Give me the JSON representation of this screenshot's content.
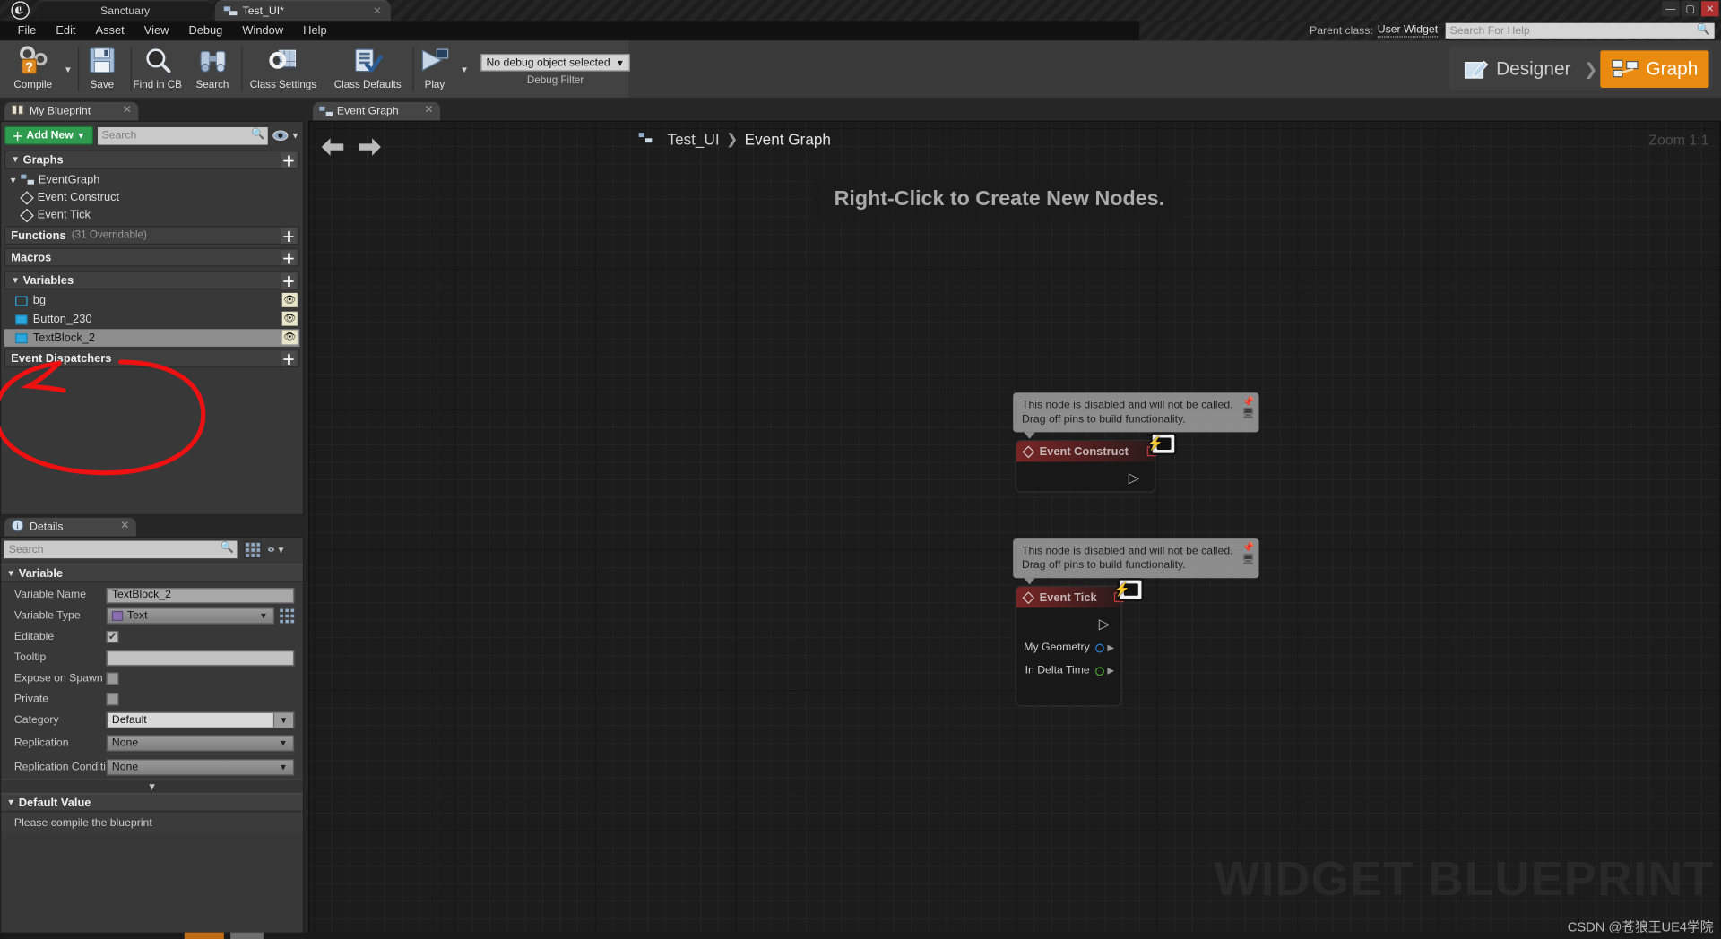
{
  "window": {
    "project_tab": "Sanctuary",
    "asset_tab": "Test_UI*",
    "minimize": "—",
    "maximize": "▢",
    "close": "✕"
  },
  "menu": {
    "items": [
      "File",
      "Edit",
      "Asset",
      "View",
      "Debug",
      "Window",
      "Help"
    ]
  },
  "help": {
    "parent_label": "Parent class:",
    "parent_value": "User Widget",
    "search_placeholder": "Search For Help"
  },
  "toolbar": {
    "compile": "Compile",
    "save": "Save",
    "find_in_cb": "Find in CB",
    "search": "Search",
    "class_settings": "Class Settings",
    "class_defaults": "Class Defaults",
    "play": "Play",
    "debug_object": "No debug object selected",
    "debug_filter": "Debug Filter",
    "mode_designer": "Designer",
    "mode_graph": "Graph",
    "mode_separator": "❯"
  },
  "my_blueprint": {
    "tab_title": "My Blueprint",
    "add_new": "Add New",
    "search_placeholder": "Search",
    "sections": {
      "graphs": "Graphs",
      "functions": "Functions",
      "functions_sub": "(31 Overridable)",
      "macros": "Macros",
      "variables": "Variables",
      "event_dispatchers": "Event Dispatchers"
    },
    "graph_tree": {
      "event_graph": "EventGraph",
      "event_construct": "Event Construct",
      "event_tick": "Event Tick"
    },
    "variables": [
      {
        "name": "bg",
        "icon": "image-variable-icon",
        "selected": false
      },
      {
        "name": "Button_230",
        "icon": "button-variable-icon",
        "selected": false
      },
      {
        "name": "TextBlock_2",
        "icon": "text-variable-icon",
        "selected": true
      }
    ]
  },
  "details": {
    "tab_title": "Details",
    "search_placeholder": "Search",
    "category_variable": "Variable",
    "category_default_value": "Default Value",
    "rows": [
      {
        "label": "Variable Name",
        "value": "TextBlock_2",
        "kind": "text"
      },
      {
        "label": "Variable Type",
        "value": "Text",
        "kind": "combo-type"
      },
      {
        "label": "Editable",
        "value": "checked",
        "kind": "checkbox"
      },
      {
        "label": "Tooltip",
        "value": "",
        "kind": "text"
      },
      {
        "label": "Expose on Spawn",
        "value": "unchecked",
        "kind": "checkbox"
      },
      {
        "label": "Private",
        "value": "unchecked",
        "kind": "checkbox"
      },
      {
        "label": "Category",
        "value": "Default",
        "kind": "combo-light"
      },
      {
        "label": "Replication",
        "value": "None",
        "kind": "combo"
      },
      {
        "label": "Replication Conditi",
        "value": "None",
        "kind": "combo"
      }
    ],
    "default_value_message": "Please compile the blueprint"
  },
  "graph": {
    "tab_title": "Event Graph",
    "breadcrumb_asset": "Test_UI",
    "breadcrumb_graph": "Event Graph",
    "breadcrumb_separator": "❯",
    "nav_back": "⬅",
    "nav_forward": "➡",
    "zoom_label": "Zoom 1:1",
    "hint": "Right-Click to Create New Nodes.",
    "watermark": "WIDGET BLUEPRINT",
    "credit": "CSDN @苍狼王UE4学院",
    "nodes": [
      {
        "title": "Event Construct",
        "tooltip_line1": "This node is disabled and will not be called.",
        "tooltip_line2": "Drag off pins to build functionality.",
        "pins": []
      },
      {
        "title": "Event Tick",
        "tooltip_line1": "This node is disabled and will not be called.",
        "tooltip_line2": "Drag off pins to build functionality.",
        "pins": [
          "My Geometry",
          "In Delta Time"
        ]
      }
    ]
  },
  "colors": {
    "accent_orange": "#e98b10",
    "add_new_green": "#2e9b4e",
    "selection_gray": "#8d8d8d",
    "node_red": "#7e2626",
    "annotation_red": "#ee1111"
  }
}
